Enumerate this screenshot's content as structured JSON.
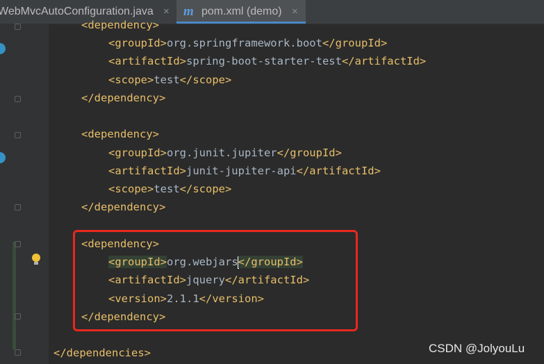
{
  "tabs": [
    {
      "label": "WebMvcAutoConfiguration.java",
      "close": "×",
      "active": false
    },
    {
      "icon": "m",
      "label": "pom.xml (demo)",
      "close": "×",
      "active": true
    }
  ],
  "code": {
    "l1": {
      "open": "<dependency>"
    },
    "l2": {
      "open": "<groupId>",
      "text": "org.springframework.boot",
      "close": "</groupId>"
    },
    "l3": {
      "open": "<artifactId>",
      "text": "spring-boot-starter-test",
      "close": "</artifactId>"
    },
    "l4": {
      "open": "<scope>",
      "text": "test",
      "close": "</scope>"
    },
    "l5": {
      "close": "</dependency>"
    },
    "l6": {
      "open": "<dependency>"
    },
    "l7": {
      "open": "<groupId>",
      "text": "org.junit.jupiter",
      "close": "</groupId>"
    },
    "l8": {
      "open": "<artifactId>",
      "text": "junit-jupiter-api",
      "close": "</artifactId>"
    },
    "l9": {
      "open": "<scope>",
      "text": "test",
      "close": "</scope>"
    },
    "l10": {
      "close": "</dependency>"
    },
    "l11": {
      "open": "<dependency>"
    },
    "l12": {
      "open": "<groupId>",
      "text": "org.webjars",
      "close": "</groupId>"
    },
    "l13": {
      "open": "<artifactId>",
      "text": "jquery",
      "close": "</artifactId>"
    },
    "l14": {
      "open": "<version>",
      "text": "2.1.1",
      "close": "</version>"
    },
    "l15": {
      "close": "</dependency>"
    },
    "l16": {
      "close": "</dependencies>"
    }
  },
  "watermark": "CSDN @JolyouLu",
  "colors": {
    "editor_bg": "#2b2b2b",
    "tag": "#e8bf6a",
    "text": "#a9b7c6",
    "annotation": "#e8281f",
    "tab_active_underline": "#4a88c7"
  },
  "icons": [
    "maven-file-icon",
    "run-gutter-icon",
    "fold-marker-icon",
    "lightbulb-icon",
    "close-icon"
  ]
}
